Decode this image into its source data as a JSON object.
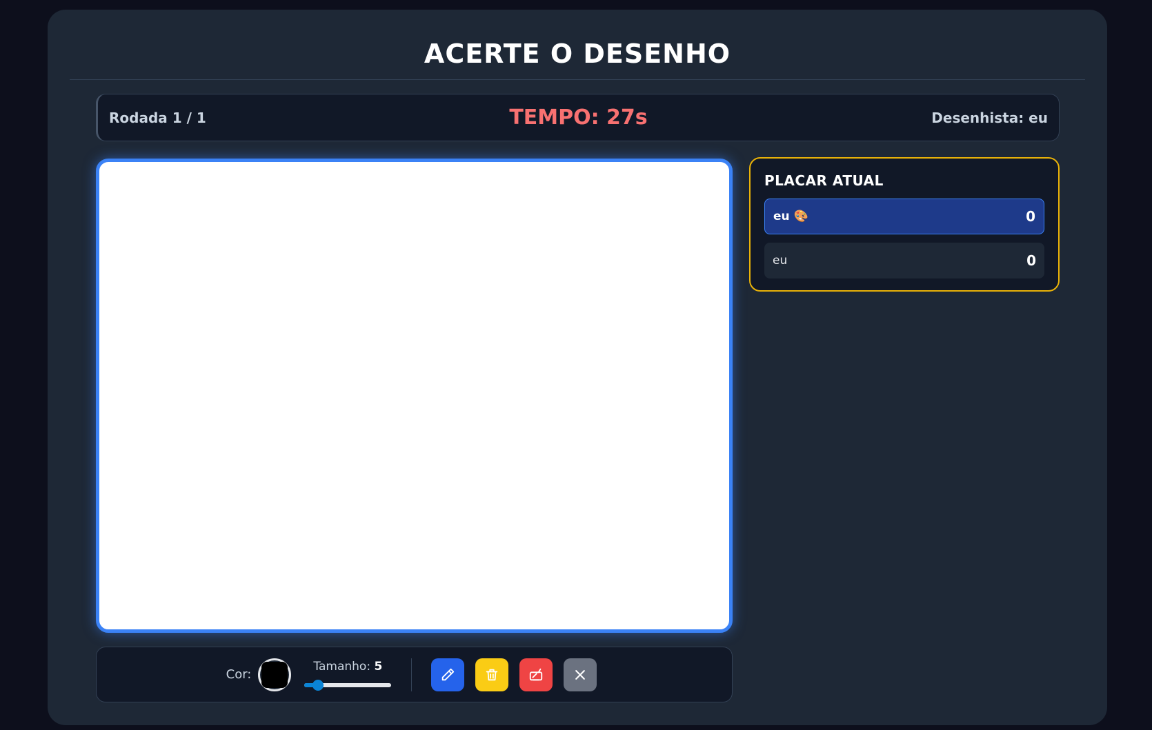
{
  "game": {
    "title": "ACERTE O DESENHO"
  },
  "status": {
    "round": "Rodada 1 / 1",
    "timer": "TEMPO: 27s",
    "drawer": "Desenhista: eu"
  },
  "toolbar": {
    "color_label": "Cor:",
    "selected_color": "#000000",
    "size_label": "Tamanho:",
    "size_value": "5",
    "size_min": 1,
    "size_max": 40,
    "tools": [
      {
        "name": "pencil-button",
        "icon": "pencil-icon",
        "color": "#2563eb"
      },
      {
        "name": "clear-button",
        "icon": "trash-icon",
        "color": "#facc15"
      },
      {
        "name": "eraser-button",
        "icon": "eraser-icon",
        "color": "#ef4444"
      },
      {
        "name": "close-button",
        "icon": "close-icon",
        "color": "#6b7280"
      }
    ]
  },
  "scoreboard": {
    "title": "PLACAR ATUAL",
    "players": [
      {
        "name": "eu 🎨",
        "score": "0",
        "drawing": true
      },
      {
        "name": "eu",
        "score": "0",
        "drawing": false
      }
    ]
  },
  "colors": {
    "accent": "#3b82f6",
    "timer": "#f87171",
    "panel_border": "#eab308"
  }
}
